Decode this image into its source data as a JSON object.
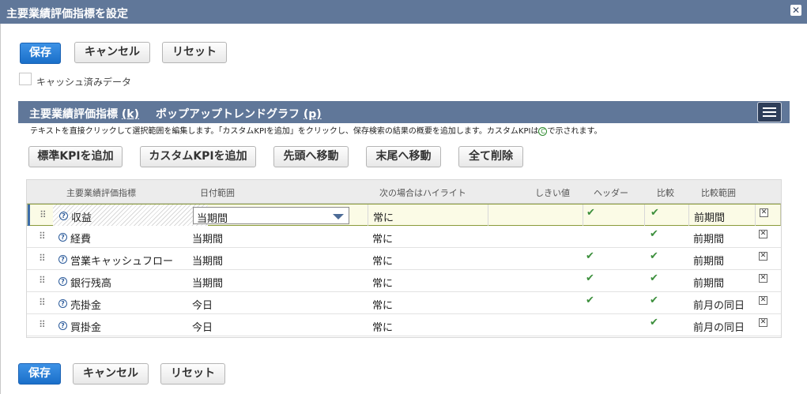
{
  "dialog": {
    "title": "主要業績評価指標を設定",
    "close_label": "✕"
  },
  "top_buttons": {
    "save": "保存",
    "cancel": "キャンセル",
    "reset": "リセット"
  },
  "cached_data": {
    "label": "キャッシュ済みデータ",
    "checked": false
  },
  "section": {
    "tab_kpi": "主要業績評価指標",
    "tab_kpi_key": "(k)",
    "tab_trend": "ポップアップトレンドグラフ",
    "tab_trend_key": "(p)"
  },
  "instructions": {
    "text_before": "テキストを直接クリックして選択範囲を編集します。「カスタムKPIを追加」をクリックし、保存検索の結果の概要を追加します。カスタムKPIは",
    "icon_letter": "C",
    "text_after": "で示されます。"
  },
  "toolbar": {
    "add_standard": "標準KPIを追加",
    "add_custom": "カスタムKPIを追加",
    "move_top": "先頭へ移動",
    "move_bottom": "末尾へ移動",
    "delete_all": "全て削除"
  },
  "table": {
    "headers": [
      "主要業績評価指標",
      "日付範囲",
      "次の場合はハイライト",
      "しきい値",
      "ヘッダー",
      "比較",
      "比較範囲"
    ],
    "rows": [
      {
        "name": "収益",
        "date_range": "当期間",
        "highlight": "常に",
        "threshold": "",
        "header": true,
        "compare": true,
        "compare_range": "前期間"
      },
      {
        "name": "経費",
        "date_range": "当期間",
        "highlight": "常に",
        "threshold": "",
        "header": false,
        "compare": true,
        "compare_range": "前期間"
      },
      {
        "name": "営業キャッシュフロー",
        "date_range": "当期間",
        "highlight": "常に",
        "threshold": "",
        "header": true,
        "compare": true,
        "compare_range": "前期間"
      },
      {
        "name": "銀行残高",
        "date_range": "当期間",
        "highlight": "常に",
        "threshold": "",
        "header": true,
        "compare": true,
        "compare_range": "前期間"
      },
      {
        "name": "売掛金",
        "date_range": "今日",
        "highlight": "常に",
        "threshold": "",
        "header": true,
        "compare": true,
        "compare_range": "前月の同日"
      },
      {
        "name": "買掛金",
        "date_range": "今日",
        "highlight": "常に",
        "threshold": "",
        "header": false,
        "compare": true,
        "compare_range": "前月の同日"
      }
    ]
  },
  "bottom_buttons": {
    "save": "保存",
    "cancel": "キャンセル",
    "reset": "リセット"
  },
  "glyphs": {
    "drag_handle": "⠿",
    "help": "?",
    "check": "✔",
    "remove": "✕"
  },
  "colors": {
    "titlebar": "#607799",
    "primary": "#1a6fc9",
    "check": "#3c8f3c"
  }
}
